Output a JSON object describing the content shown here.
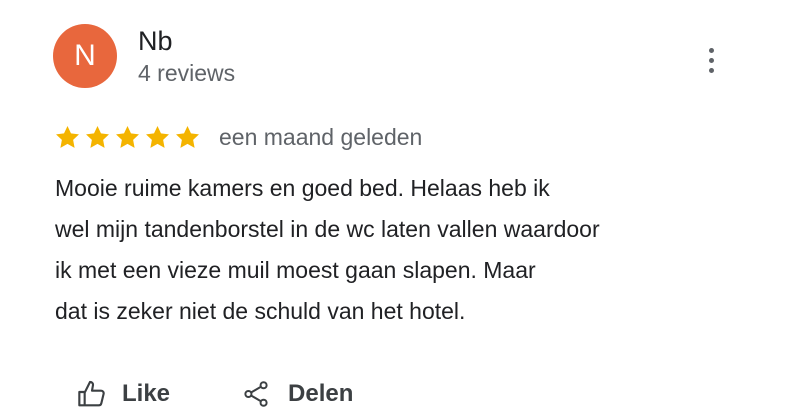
{
  "review": {
    "author": {
      "initial": "N",
      "name": "Nb",
      "review_count": "4 reviews",
      "avatar_color": "#e8673d"
    },
    "more_icon": "more-vert-icon",
    "rating": 5,
    "rating_max": 5,
    "star_color": "#f4b400",
    "date": "een maand geleden",
    "text_lines": [
      "Mooie ruime kamers en goed bed. Helaas heb ik",
      "wel mijn tandenborstel in de wc laten vallen waardoor",
      "ik met een vieze muil moest gaan slapen. Maar",
      "dat is zeker niet de schuld van het hotel."
    ],
    "actions": {
      "like": {
        "label": "Like",
        "icon": "thumbs-up-icon"
      },
      "share": {
        "label": "Delen",
        "icon": "share-icon"
      }
    }
  }
}
